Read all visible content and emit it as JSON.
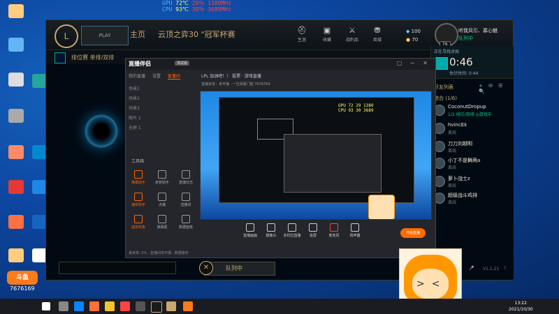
{
  "stats_overlay": {
    "row1": {
      "label": "GPU",
      "v1": "72",
      "u1": "℃",
      "v2": "29",
      "u2": "％",
      "v3": "1380",
      "u3": "MHz"
    },
    "row2": {
      "label": "CPU",
      "v1": "93",
      "u1": "℃",
      "v2": "30",
      "u2": "％",
      "v3": "3689",
      "u3": "MHz"
    }
  },
  "client": {
    "play_label": "PLAY",
    "nav_home": "主页",
    "title_text": "云顶之弈30 \"冠军杯赛",
    "nav_items": [
      {
        "icon": "helmet-icon",
        "label": "生涯"
      },
      {
        "icon": "chest-icon",
        "label": "收藏"
      },
      {
        "icon": "sword-icon",
        "label": "战利品"
      },
      {
        "icon": "store-icon",
        "label": "商城"
      }
    ],
    "currency": {
      "be": "100",
      "rp": "70"
    },
    "level": "76",
    "profile": {
      "name": "听我风引、慕心魅",
      "status": "队列中"
    },
    "mode": "排位赛 单排/双排",
    "queue_button": "队列中"
  },
  "social": {
    "queue_label": "正在寻找对局",
    "queue_time": "0:46",
    "queue_est": "估计时间: 0:44",
    "header": "好友列表",
    "tools": "+ ✉ ☰ 🔍",
    "group": "综合 (1/6)",
    "friends": [
      {
        "name": "CoconutDropup",
        "status": "1/2 排位/双排 ◎游戏中",
        "ingame": true
      },
      {
        "name": "hvincEk",
        "status": "离线",
        "ingame": false
      },
      {
        "name": "刀刀刘越明",
        "status": "离线",
        "ingame": false
      },
      {
        "name": "小丁不是舞两a",
        "status": "离线",
        "ingame": false
      },
      {
        "name": "萝卜战士z",
        "status": "离线",
        "ingame": false
      },
      {
        "name": "超级战斗鸡排",
        "status": "离线",
        "ingame": false
      }
    ],
    "version": "V1.1.21"
  },
  "stream_app": {
    "title": "直播伴侣",
    "badge": "测试版",
    "tabs": [
      "我的直播",
      "设置",
      "直播间"
    ],
    "live_info": "LPL 加油吧！！    投票  ·  游戏直播",
    "live_info2": "直播状态：未开播 · 一位观看门槛 7676769",
    "scenes": [
      "场景1",
      "场景2",
      "场景3",
      "图片 1",
      "全屏 1"
    ],
    "tools_title": "工具箱",
    "tools": [
      {
        "label": "弹幕助手",
        "hot": true
      },
      {
        "label": "房管助手",
        "hot": false
      },
      {
        "label": "直播日志",
        "hot": false
      },
      {
        "label": "抽奖助手",
        "hot": true
      },
      {
        "label": "点播",
        "hot": false
      },
      {
        "label": "直播间",
        "hot": false
      },
      {
        "label": "虚拟形象",
        "hot": true
      },
      {
        "label": "弹幕姬",
        "hot": false
      },
      {
        "label": "数据面板",
        "hot": false
      }
    ],
    "footer": "丢帧率: 0%  · 直播间未开播 · 数据缓存",
    "bottom_buttons": [
      "直播画面",
      "摄像头",
      "多机位直播",
      "投屏",
      "麦克风",
      "扬声器"
    ],
    "start_live": "开始直播"
  },
  "branding": {
    "site": "斗鱼",
    "room": "7676169"
  },
  "taskbar": {
    "time": "13:22",
    "date": "2021/10/30"
  }
}
